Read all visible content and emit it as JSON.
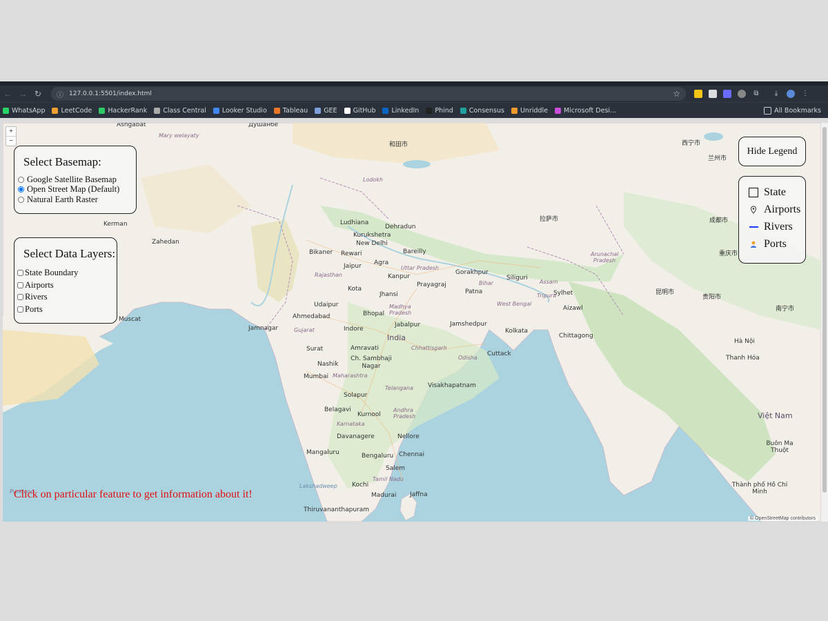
{
  "browser": {
    "url": "127.0.0.1:5501/index.html",
    "bookmarks": [
      {
        "label": "WhatsApp",
        "color": "#25d366"
      },
      {
        "label": "LeetCode",
        "color": "#f0a030"
      },
      {
        "label": "HackerRank",
        "color": "#2ec866"
      },
      {
        "label": "Class Central",
        "color": "#aaaaaa"
      },
      {
        "label": "Looker Studio",
        "color": "#4285f4"
      },
      {
        "label": "Tableau",
        "color": "#e97627"
      },
      {
        "label": "GEE",
        "color": "#7e9fd8"
      },
      {
        "label": "GitHub",
        "color": "#ffffff"
      },
      {
        "label": "LinkedIn",
        "color": "#0a66c2"
      },
      {
        "label": "Phind",
        "color": "#222222"
      },
      {
        "label": "Consensus",
        "color": "#21a0a0"
      },
      {
        "label": "Unriddle",
        "color": "#f29a2e"
      },
      {
        "label": "Microsoft Desi...",
        "color": "#c94fd8"
      }
    ],
    "all_bookmarks": "All Bookmarks"
  },
  "map": {
    "zoom_in": "+",
    "zoom_out": "−",
    "labels": {
      "l1": "Ashgabat",
      "l2": "Mary welayaty",
      "l3": "Душанбе",
      "l4": "和田市",
      "l5": "西宁市",
      "l6": "兰州市",
      "l7": "Lodokh",
      "l8": "Ludhiana",
      "l9": "Dehradun",
      "l10": "New Delhi",
      "l11": "Kurukshetra",
      "l12": "Bikaner",
      "l13": "Rewari",
      "l14": "Bareilly",
      "l15": "Jaipur",
      "l16": "Agra",
      "l17": "Uttar Pradesh",
      "l18": "Kanpur",
      "l19": "Gorakhpur",
      "l20": "Siliguri",
      "l21": "Rajasthan",
      "l22": "Kota",
      "l23": "Jhansi",
      "l24": "Prayagraj",
      "l25": "Patna",
      "l26": "Bihar",
      "l27": "Udaipur",
      "l28": "Bhopal",
      "l29": "Madhya Pradesh",
      "l30": "West Bengal",
      "l31": "Aizawl",
      "l32": "Ahmedabad",
      "l33": "Gujarat",
      "l34": "Jamnagar",
      "l35": "Indore",
      "l36": "Jabalpur",
      "l37": "Jamshedpur",
      "l38": "Kolkata",
      "l39": "India",
      "l40": "Surat",
      "l41": "Amravati",
      "l42": "Chhattisgarh",
      "l43": "Odisha",
      "l44": "Cuttack",
      "l45": "Nashik",
      "l46": "Ch. Sambhaji Nagar",
      "l47": "Mumbai",
      "l48": "Maharashtra",
      "l49": "Telangana",
      "l50": "Visakhapatnam",
      "l51": "Solapur",
      "l52": "Belagavi",
      "l53": "Kurnool",
      "l54": "Andhra Pradesh",
      "l55": "Karnataka",
      "l56": "Davanagere",
      "l57": "Nellore",
      "l58": "Mangaluru",
      "l59": "Bengaluru",
      "l60": "Chennai",
      "l61": "Salem",
      "l62": "Tamil Nadu",
      "l63": "Lakshadweep",
      "l64": "Kochi",
      "l65": "Madurai",
      "l66": "Jaffna",
      "l67": "Thiruvananthapuram",
      "l68": "Việt Nam",
      "l69": "Hà Nội",
      "l70": "Thanh Hóa",
      "l71": "Buôn Ma Thuột",
      "l72": "Thành phố Hồ Chí Minh",
      "l73": "成都市",
      "l74": "重庆市",
      "l75": "昆明市",
      "l76": "贵阳市",
      "l77": "南宁市",
      "l78": "Arunachal Pradesh",
      "l79": "拉萨市",
      "l80": "Assam",
      "l81": "Tripura",
      "l82": "Puntland",
      "l83": "Kerman",
      "l84": "Zahedan",
      "l85": "Muscat",
      "l86": "Sylhet",
      "l87": "Chittagong"
    },
    "attribution": "© OpenStreetMap contributors"
  },
  "basemap_panel": {
    "title": "Select Basemap:",
    "options": [
      {
        "label": "Google Satellite Basemap",
        "checked": false
      },
      {
        "label": "Open Street Map (Default)",
        "checked": true
      },
      {
        "label": "Natural Earth Raster",
        "checked": false
      }
    ]
  },
  "layers_panel": {
    "title": "Select Data Layers:",
    "layers": [
      "State Boundary",
      "Airports",
      "Rivers",
      "Ports"
    ]
  },
  "legend": {
    "toggle_label": "Hide Legend",
    "items": [
      {
        "label": "State",
        "symbol": "square-outline"
      },
      {
        "label": "Airports",
        "symbol": "airport-pin-icon"
      },
      {
        "label": "Rivers",
        "symbol": "blue-line"
      },
      {
        "label": "Ports",
        "symbol": "port-icon"
      }
    ]
  },
  "info_message": "Click on particular feature to get information about it!"
}
